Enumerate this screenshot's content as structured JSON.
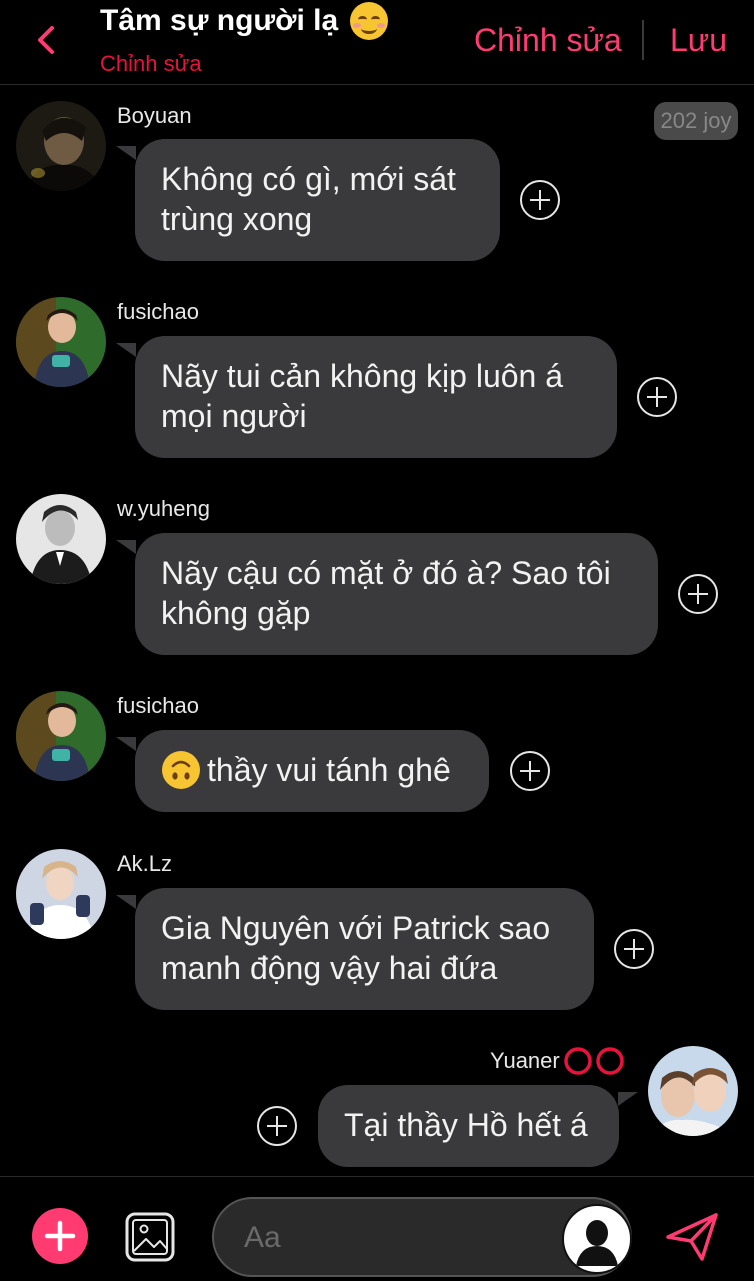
{
  "header": {
    "title": "Tâm sự người lạ",
    "subtitle": "Chỉnh sửa",
    "edit_label": "Chỉnh sửa",
    "save_label": "Lưu"
  },
  "joy_badge": "202 joy",
  "messages": [
    {
      "sender": "Boyuan",
      "text": "Không có gì, mới sát trùng xong",
      "side": "left"
    },
    {
      "sender": "fusichao",
      "text": "Nãy tui cản không kịp luôn á mọi người",
      "side": "left"
    },
    {
      "sender": "w.yuheng",
      "text": "Nãy cậu có mặt ở đó à? Sao tôi không gặp",
      "side": "left"
    },
    {
      "sender": "fusichao",
      "text": "thầy vui tánh ghê",
      "side": "left",
      "emoji": "upside-down-face"
    },
    {
      "sender": "Ak.Lz",
      "text": "Gia Nguyên với Patrick sao manh động vậy hai đứa",
      "side": "left"
    },
    {
      "sender": "Yuaner",
      "text": "Tại thầy Hồ hết á",
      "side": "right"
    }
  ],
  "composer": {
    "placeholder": "Aa"
  },
  "colors": {
    "accent": "#ff3b72",
    "subtitle_red": "#e8123c",
    "bubble": "#3a3a3c",
    "background": "#000000"
  }
}
